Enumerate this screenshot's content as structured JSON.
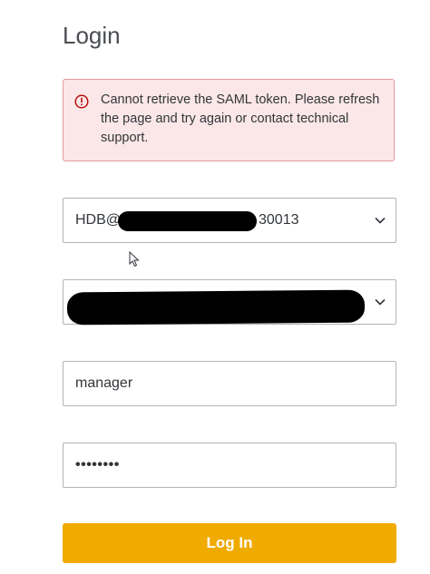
{
  "page": {
    "title": "Login"
  },
  "error": {
    "icon": "error-circle-icon",
    "message": "Cannot retrieve the SAML token. Please refresh the page and try again or contact technical support.",
    "color": "#bb0000"
  },
  "system_select": {
    "prefix": "HDB@",
    "suffix": "30013"
  },
  "user_select": {
    "value": ""
  },
  "username": {
    "value": "manager"
  },
  "password": {
    "value": "••••••••"
  },
  "login_button": {
    "label": "Log In",
    "color": "#f0ab00"
  }
}
